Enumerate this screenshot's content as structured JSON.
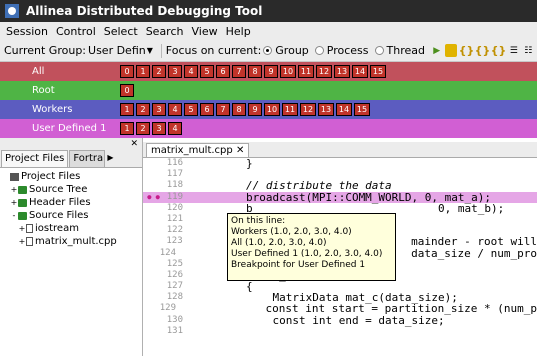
{
  "window": {
    "title": "Allinea Distributed Debugging Tool"
  },
  "menu": [
    "Session",
    "Control",
    "Select",
    "Search",
    "View",
    "Help"
  ],
  "toolbar": {
    "current_group_label": "Current Group:",
    "current_group_value": "User Defin",
    "focus_label": "Focus on current:",
    "focus_options": [
      "Group",
      "Process",
      "Thread"
    ],
    "focus_selected": "Group"
  },
  "groups": [
    {
      "name": "All",
      "color": "#c1515c",
      "procs": [
        "0",
        "1",
        "2",
        "3",
        "4",
        "5",
        "6",
        "7",
        "8",
        "9",
        "10",
        "11",
        "12",
        "13",
        "14",
        "15"
      ]
    },
    {
      "name": "Root",
      "color": "#4fb445",
      "procs": [
        "0"
      ]
    },
    {
      "name": "Workers",
      "color": "#5c5cc0",
      "procs": [
        "1",
        "2",
        "3",
        "4",
        "5",
        "6",
        "7",
        "8",
        "9",
        "10",
        "11",
        "12",
        "13",
        "14",
        "15"
      ]
    },
    {
      "name": "User Defined 1",
      "color": "#d15fd3",
      "procs": [
        "1",
        "2",
        "3",
        "4"
      ]
    }
  ],
  "left_pane": {
    "tabs": [
      "Project Files",
      "Fortra"
    ],
    "tree": [
      {
        "label": "Project Files",
        "level": 0,
        "icon": "project-icon",
        "exp": ""
      },
      {
        "label": "Source Tree",
        "level": 1,
        "icon": "folder-icon",
        "exp": "+"
      },
      {
        "label": "Header Files",
        "level": 1,
        "icon": "folder-icon",
        "exp": "+"
      },
      {
        "label": "Source Files",
        "level": 1,
        "icon": "folder-icon",
        "exp": "-"
      },
      {
        "label": "iostream",
        "level": 2,
        "icon": "file-icon",
        "exp": "+"
      },
      {
        "label": "matrix_mult.cpp",
        "level": 2,
        "icon": "file-icon",
        "exp": "+"
      }
    ]
  },
  "editor": {
    "file_tab": "matrix_mult.cpp",
    "lines": [
      {
        "no": "116",
        "text": "        }"
      },
      {
        "no": "117",
        "text": ""
      },
      {
        "no": "118",
        "text": "        // distribute the data"
      },
      {
        "no": "119",
        "text": "        broadcast(MPI::COMM_WORLD, 0, mat_a);"
      },
      {
        "no": "120",
        "text": "        b                            0, mat_b);"
      },
      {
        "no": "121",
        "text": ""
      },
      {
        "no": "122",
        "text": "        /"
      },
      {
        "no": "123",
        "text": "        /                        mainder - root will"
      },
      {
        "no": "124",
        "text": "        c                         data_size / num_pro"
      },
      {
        "no": "125",
        "text": ""
      },
      {
        "no": "126",
        "text": "        if(my_rank == 0)"
      },
      {
        "no": "127",
        "text": "        {"
      },
      {
        "no": "128",
        "text": "            MatrixData mat_c(data_size);"
      },
      {
        "no": "129",
        "text": "            const int start = partition_size * (num_p"
      },
      {
        "no": "130",
        "text": "            const int end = data_size;"
      },
      {
        "no": "131",
        "text": ""
      }
    ],
    "tooltip": [
      "On this line:",
      "Workers (1.0, 2.0, 3.0, 4.0)",
      "All (1.0, 2.0, 3.0, 4.0)",
      "User Defined 1 (1.0, 2.0, 3.0, 4.0)",
      "Breakpoint for User Defined 1"
    ]
  }
}
